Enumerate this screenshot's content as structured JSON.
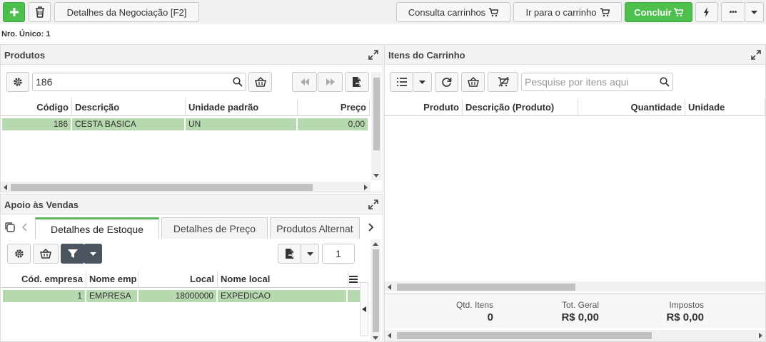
{
  "toolbar": {
    "negotiation_details_label": "Detalhes da Negociação [F2]",
    "consult_carts_label": "Consulta carrinhos",
    "go_to_cart_label": "Ir para o carrinho",
    "conclude_label": "Concluir",
    "more_label": "•••"
  },
  "nro_unico": "Nro. Único: 1",
  "produtos": {
    "title": "Produtos",
    "search_value": "186",
    "columns": [
      "Código",
      "Descrição",
      "Unidade padrão",
      "Preço"
    ],
    "rows": [
      {
        "codigo": "186",
        "descricao": "CESTA BASICA",
        "unidade": "UN",
        "preco": "0,00"
      }
    ]
  },
  "apoio": {
    "title": "Apoio às Vendas",
    "tabs": [
      "Detalhes de Estoque",
      "Detalhes de Preço",
      "Produtos Alternat"
    ],
    "page_value": "1",
    "columns": [
      "Cód. empresa",
      "Nome emp",
      "Local",
      "Nome local"
    ],
    "rows": [
      {
        "cod_empresa": "1",
        "nome_emp": "EMPRESA",
        "local": "18000000",
        "nome_local": "EXPEDICAO"
      }
    ]
  },
  "carrinho": {
    "title": "Itens do Carrinho",
    "search_placeholder": "Pesquise por itens aqui",
    "columns": [
      "Produto",
      "Descrição (Produto)",
      "Quantidade",
      "Unidade"
    ],
    "totals": {
      "qtd_label": "Qtd. Itens",
      "qtd_value": "0",
      "geral_label": "Tot. Geral",
      "geral_value": "R$ 0,00",
      "impostos_label": "Impostos",
      "impostos_value": "R$ 0,00"
    }
  },
  "colors": {
    "green": "#4cbf4c",
    "row_highlight": "#b7d9b0",
    "dark_button": "#4b555f"
  }
}
